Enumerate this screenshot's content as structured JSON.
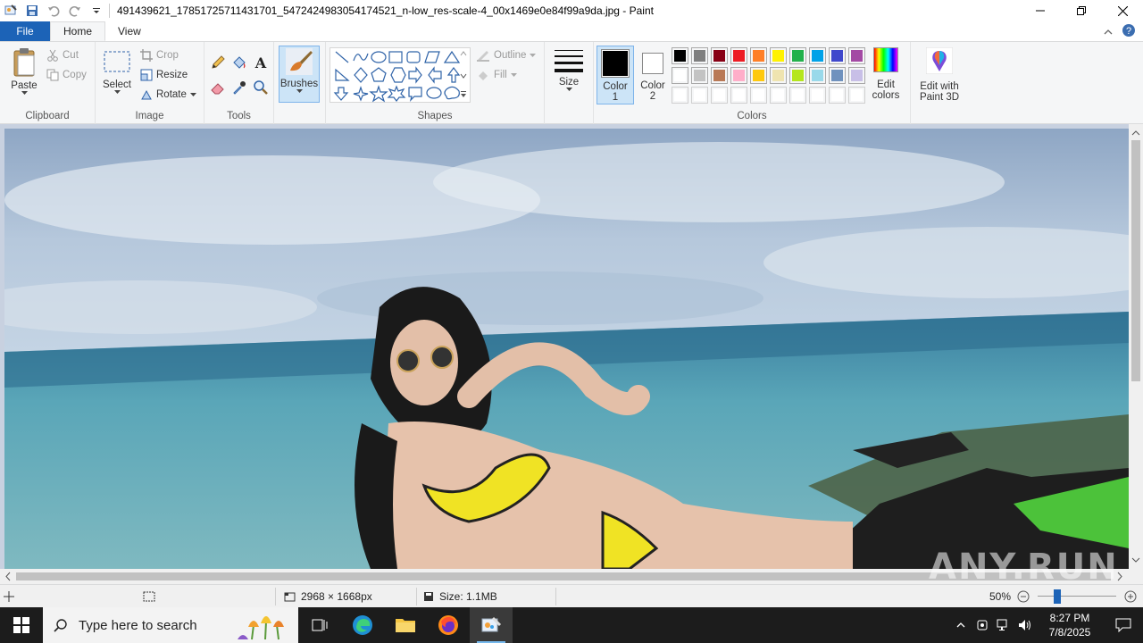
{
  "window": {
    "title": "491439621_17851725711431701_5472424983054174521_n-low_res-scale-4_00x1469e0e84f99a9da.jpg - Paint",
    "minimize": "—",
    "maximize": "❐",
    "close": "✕"
  },
  "menu": {
    "file": "File",
    "tabs": [
      "Home",
      "View"
    ]
  },
  "ribbon": {
    "clipboard": {
      "label": "Clipboard",
      "paste": "Paste",
      "cut": "Cut",
      "copy": "Copy"
    },
    "image": {
      "label": "Image",
      "select": "Select",
      "crop": "Crop",
      "resize": "Resize",
      "rotate": "Rotate"
    },
    "tools": {
      "label": "Tools"
    },
    "brushes": {
      "label": "Brushes"
    },
    "shapes": {
      "label": "Shapes",
      "outline": "Outline",
      "fill": "Fill"
    },
    "size": {
      "label": "Size"
    },
    "colors": {
      "label": "Colors",
      "color1": "Color 1",
      "color1_line1": "Color",
      "color1_line2": "1",
      "color2_line1": "Color",
      "color2_line2": "2",
      "edit_colors_line1": "Edit",
      "edit_colors_line2": "colors",
      "paint3d_line1": "Edit with",
      "paint3d_line2": "Paint 3D",
      "palette_row1": [
        "#000000",
        "#7f7f7f",
        "#880015",
        "#ed1c24",
        "#ff7f27",
        "#fff200",
        "#22b14c",
        "#00a2e8",
        "#3f48cc",
        "#a349a4"
      ],
      "palette_row2": [
        "#ffffff",
        "#c3c3c3",
        "#b97a57",
        "#ffaec9",
        "#ffc90e",
        "#efe4b0",
        "#b5e61d",
        "#99d9ea",
        "#7092be",
        "#c8bfe7"
      ],
      "palette_row3": [
        "#ffffff",
        "#ffffff",
        "#ffffff",
        "#ffffff",
        "#ffffff",
        "#ffffff",
        "#ffffff",
        "#ffffff",
        "#ffffff",
        "#ffffff"
      ]
    }
  },
  "status": {
    "dimensions": "2968 × 1668px",
    "size": "Size: 1.1MB",
    "zoom": "50%"
  },
  "taskbar": {
    "search_placeholder": "Type here to search",
    "time": "8:27 PM",
    "date": "7/8/2025"
  },
  "watermark": "ANY.RUN"
}
